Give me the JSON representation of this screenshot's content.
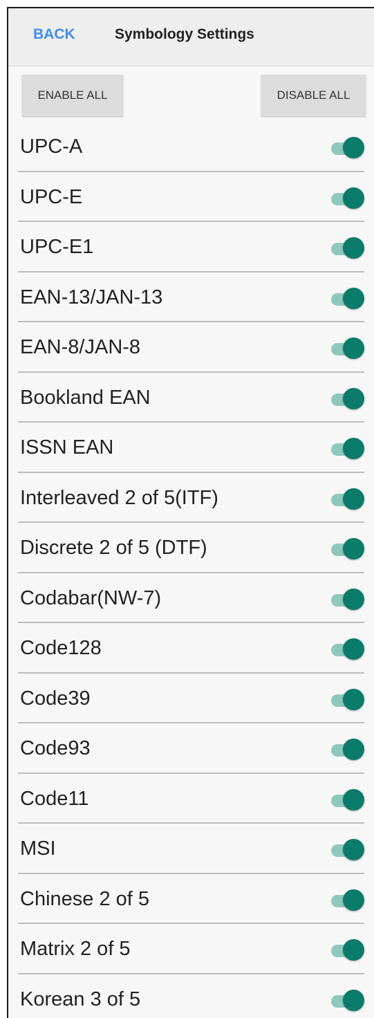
{
  "header": {
    "back_label": "BACK",
    "title": "Symbology Settings"
  },
  "actions": {
    "enable_all_label": "ENABLE ALL",
    "disable_all_label": "DISABLE ALL"
  },
  "colors": {
    "accent_link": "#3d8ef0",
    "toggle_thumb_on": "#0a7c69",
    "toggle_track_on": "#8ec8bd"
  },
  "symbologies": [
    {
      "label": "UPC-A",
      "enabled": true
    },
    {
      "label": "UPC-E",
      "enabled": true
    },
    {
      "label": "UPC-E1",
      "enabled": true
    },
    {
      "label": "EAN-13/JAN-13",
      "enabled": true
    },
    {
      "label": "EAN-8/JAN-8",
      "enabled": true
    },
    {
      "label": "Bookland EAN",
      "enabled": true
    },
    {
      "label": "ISSN EAN",
      "enabled": true
    },
    {
      "label": "Interleaved 2 of 5(ITF)",
      "enabled": true
    },
    {
      "label": "Discrete 2 of 5 (DTF)",
      "enabled": true
    },
    {
      "label": "Codabar(NW-7)",
      "enabled": true
    },
    {
      "label": "Code128",
      "enabled": true
    },
    {
      "label": "Code39",
      "enabled": true
    },
    {
      "label": "Code93",
      "enabled": true
    },
    {
      "label": "Code11",
      "enabled": true
    },
    {
      "label": "MSI",
      "enabled": true
    },
    {
      "label": "Chinese 2 of 5",
      "enabled": true
    },
    {
      "label": "Matrix 2 of 5",
      "enabled": true
    },
    {
      "label": "Korean 3 of 5",
      "enabled": true
    }
  ]
}
